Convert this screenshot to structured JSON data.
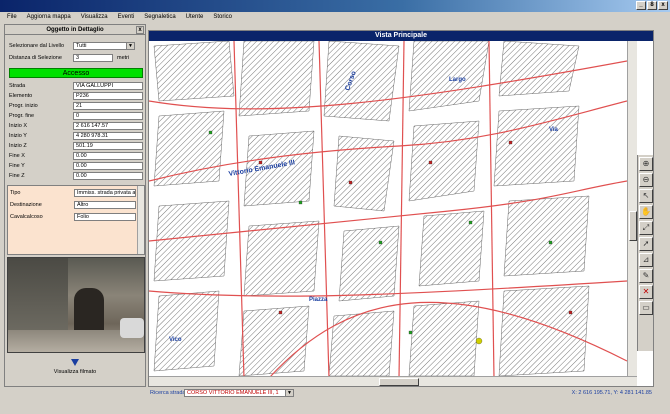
{
  "menu": [
    "File",
    "Aggiorna mappa",
    "Visualizza",
    "Eventi",
    "Segnaletica",
    "Utente",
    "Storico"
  ],
  "window_buttons": [
    "_",
    "8",
    "x"
  ],
  "left_panel": {
    "title": "Oggetto in Dettaglio",
    "close": "x",
    "livello_label": "Selezionare dal Livello",
    "livello_value": "Tutti",
    "distanza_label": "Distanza di Selezione",
    "distanza_value": "3",
    "distanza_unit": "metri",
    "accesso": "Accesso",
    "fields": [
      {
        "label": "Strada",
        "value": "VIA GALLUPPI"
      },
      {
        "label": "Elemento",
        "value": "P236"
      },
      {
        "label": "Progr. inizio",
        "value": "21"
      },
      {
        "label": "Progr. fine",
        "value": "0"
      },
      {
        "label": "Inizio X",
        "value": "2 616 147.57"
      },
      {
        "label": "Inizio Y",
        "value": "4 280 978.31"
      },
      {
        "label": "Inizio Z",
        "value": "501.19"
      },
      {
        "label": "Fine X",
        "value": "0.00"
      },
      {
        "label": "Fine Y",
        "value": "0.00"
      },
      {
        "label": "Fine Z",
        "value": "0.00"
      }
    ],
    "tipo_fields": [
      {
        "label": "Tipo",
        "value": "Immiss. strada privata a ra"
      },
      {
        "label": "Destinazione",
        "value": "Altro"
      },
      {
        "label": "Cavalcalcoso",
        "value": "Folio"
      }
    ],
    "play_label": "Visualizza filmato"
  },
  "main_panel": {
    "title": "Vista Principale",
    "map_labels": [
      "Vittorio Emanuele III",
      "Corso",
      "Largo",
      "Piazza",
      "Via",
      "Vico"
    ]
  },
  "toolbar_icons": [
    "zoom-in-icon",
    "zoom-out-icon",
    "pointer-icon",
    "pan-hand-icon",
    "fit-icon",
    "arrow-icon",
    "measure-icon",
    "pencil-icon",
    "delete-icon",
    "select-icon"
  ],
  "status": {
    "search_label": "Ricerca strada",
    "search_value": "CORSO VITTORIO EMANUELE III, 1",
    "coords": "X: 2 616 195.71, Y: 4 281 141.85"
  },
  "colors": {
    "title_bar": "#0a246a",
    "accesso": "#00e000",
    "road": "#e05050",
    "marker_blue": "#1a3ea0"
  }
}
